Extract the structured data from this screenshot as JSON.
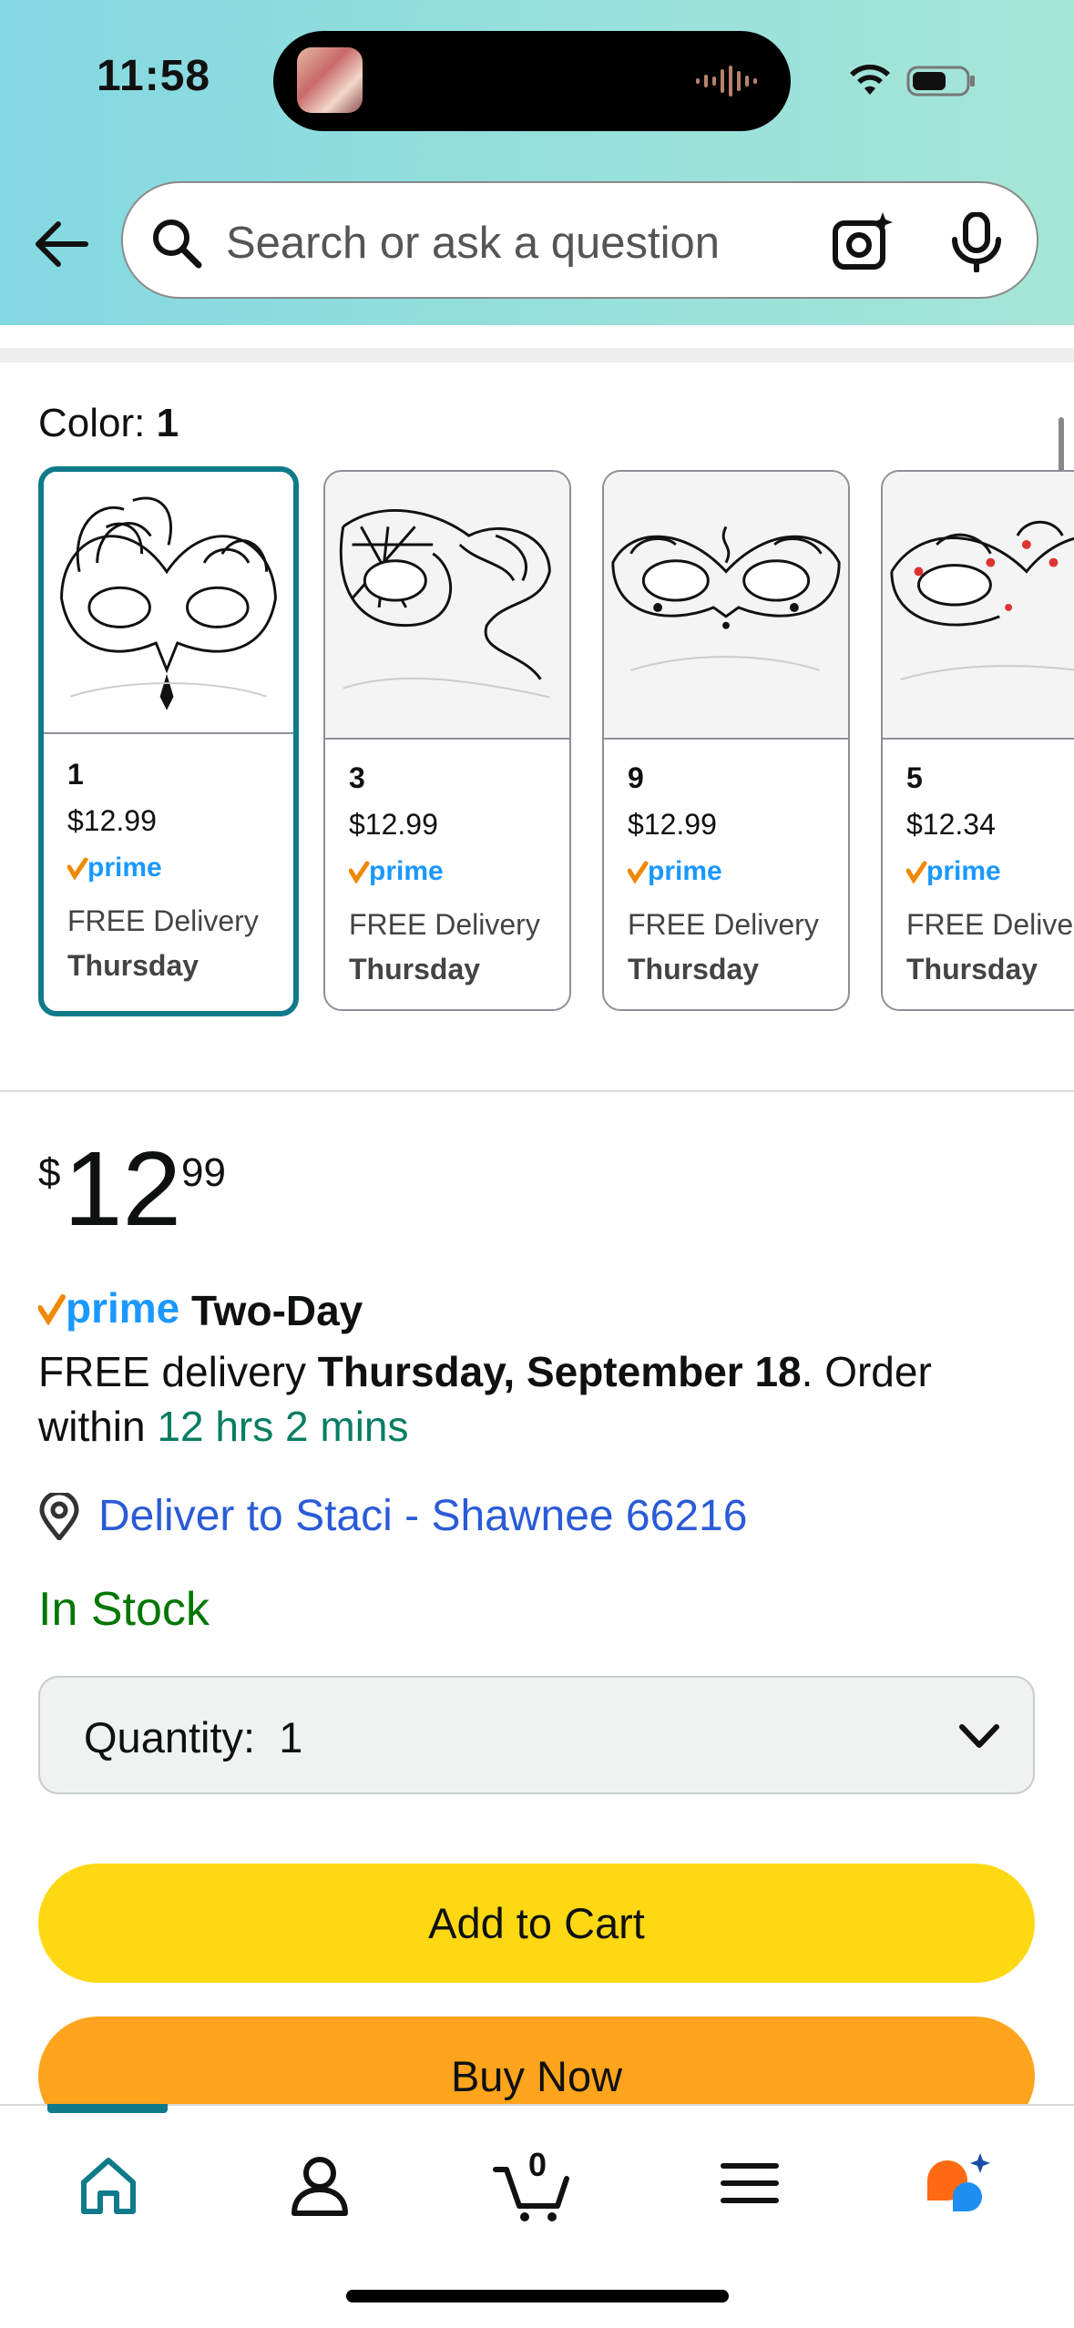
{
  "status_bar": {
    "time": "11:58"
  },
  "search": {
    "placeholder": "Search or ask a question"
  },
  "color_selector": {
    "label": "Color: ",
    "selected": "1",
    "options": [
      {
        "name": "1",
        "price": "$12.99",
        "delivery": "FREE Delivery",
        "day": "Thursday",
        "selected": true
      },
      {
        "name": "3",
        "price": "$12.99",
        "delivery": "FREE Delivery",
        "day": "Thursday",
        "selected": false
      },
      {
        "name": "9",
        "price": "$12.99",
        "delivery": "FREE Delivery",
        "day": "Thursday",
        "selected": false
      },
      {
        "name": "5",
        "price": "$12.34",
        "delivery": "FREE Delivery",
        "day": "Thursday",
        "selected": false
      }
    ]
  },
  "price": {
    "currency": "$",
    "whole": "12",
    "fraction": "99"
  },
  "prime": {
    "logo_text": "prime",
    "shipping": "Two-Day"
  },
  "delivery": {
    "prefix": "FREE delivery ",
    "date": "Thursday, September 18",
    "middle": ". Order within ",
    "countdown": "12 hrs 2 mins"
  },
  "deliver_to": "Deliver to Staci - Shawnee 66216",
  "availability": "In Stock",
  "quantity": {
    "label": "Quantity:",
    "value": "1"
  },
  "buttons": {
    "add_to_cart": "Add to Cart",
    "buy_now": "Buy Now"
  },
  "tabbar": {
    "cart_count": "0",
    "items": [
      "home-icon",
      "account-icon",
      "cart-icon",
      "menu-icon",
      "rufus-icon"
    ]
  },
  "colors": {
    "accent": "#0f7a8a",
    "add_to_cart": "#ffd814",
    "buy_now": "#ffa41c",
    "in_stock": "#007600",
    "link": "#2a5bd7"
  }
}
